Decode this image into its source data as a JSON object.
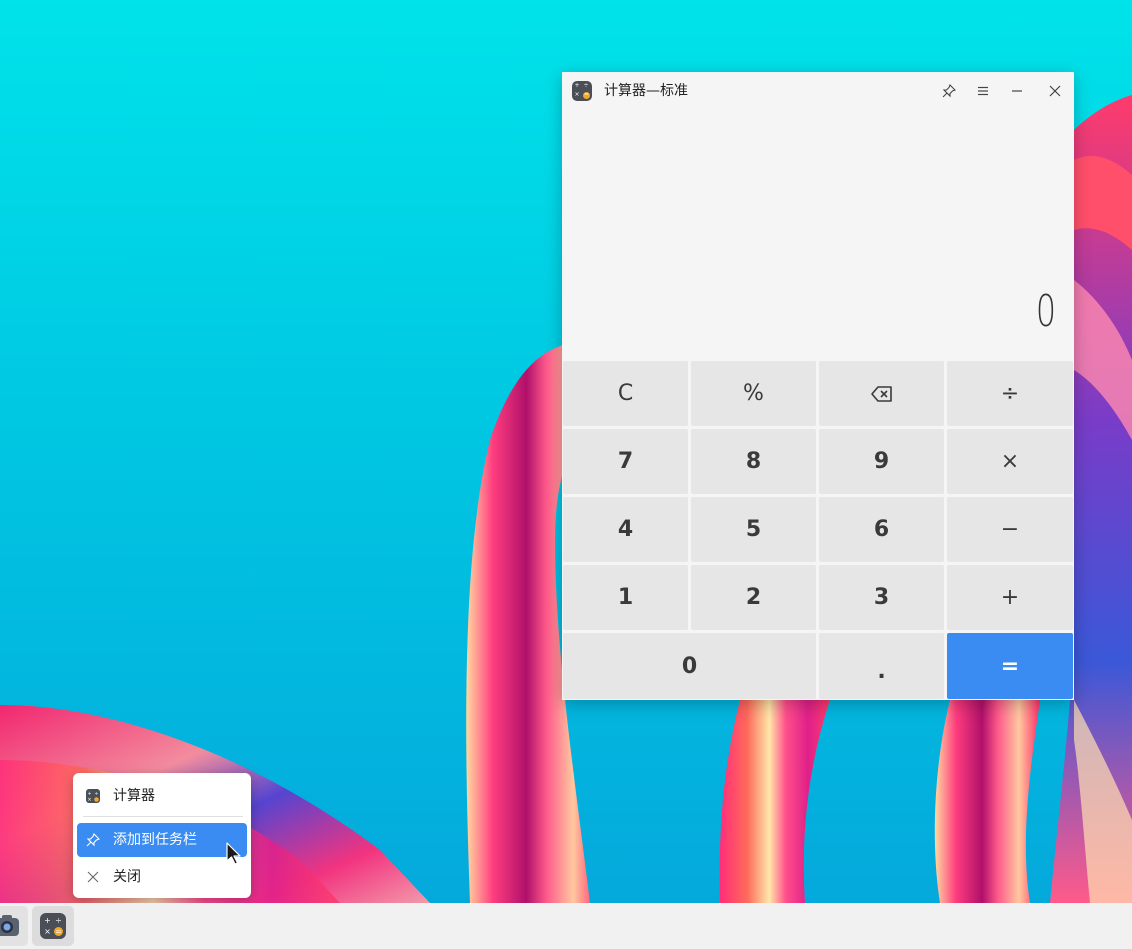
{
  "window": {
    "title": "计算器—标准",
    "display_value": "0"
  },
  "keypad": {
    "keys": [
      {
        "label": "C",
        "role": "clear"
      },
      {
        "label": "%",
        "role": "percent"
      },
      {
        "label": "",
        "role": "backspace",
        "icon": "backspace-icon"
      },
      {
        "label": "÷",
        "role": "divide"
      },
      {
        "label": "7",
        "role": "digit"
      },
      {
        "label": "8",
        "role": "digit"
      },
      {
        "label": "9",
        "role": "digit"
      },
      {
        "label": "×",
        "role": "multiply"
      },
      {
        "label": "4",
        "role": "digit"
      },
      {
        "label": "5",
        "role": "digit"
      },
      {
        "label": "6",
        "role": "digit"
      },
      {
        "label": "−",
        "role": "subtract"
      },
      {
        "label": "1",
        "role": "digit"
      },
      {
        "label": "2",
        "role": "digit"
      },
      {
        "label": "3",
        "role": "digit"
      },
      {
        "label": "+",
        "role": "add"
      },
      {
        "label": "0",
        "role": "digit"
      },
      {
        "label": ".",
        "role": "decimal"
      },
      {
        "label": "=",
        "role": "equals"
      }
    ],
    "accent_color": "#3a8cf2"
  },
  "context_menu": {
    "items": [
      {
        "label": "计算器",
        "icon": "calculator-icon"
      },
      {
        "label": "添加到任务栏",
        "icon": "pin-icon",
        "highlighted": true
      },
      {
        "label": "关闭",
        "icon": "close-icon"
      }
    ]
  },
  "taskbar": {
    "items": [
      {
        "app": "camera",
        "icon": "camera-icon"
      },
      {
        "app": "calculator",
        "icon": "calculator-icon"
      }
    ]
  }
}
